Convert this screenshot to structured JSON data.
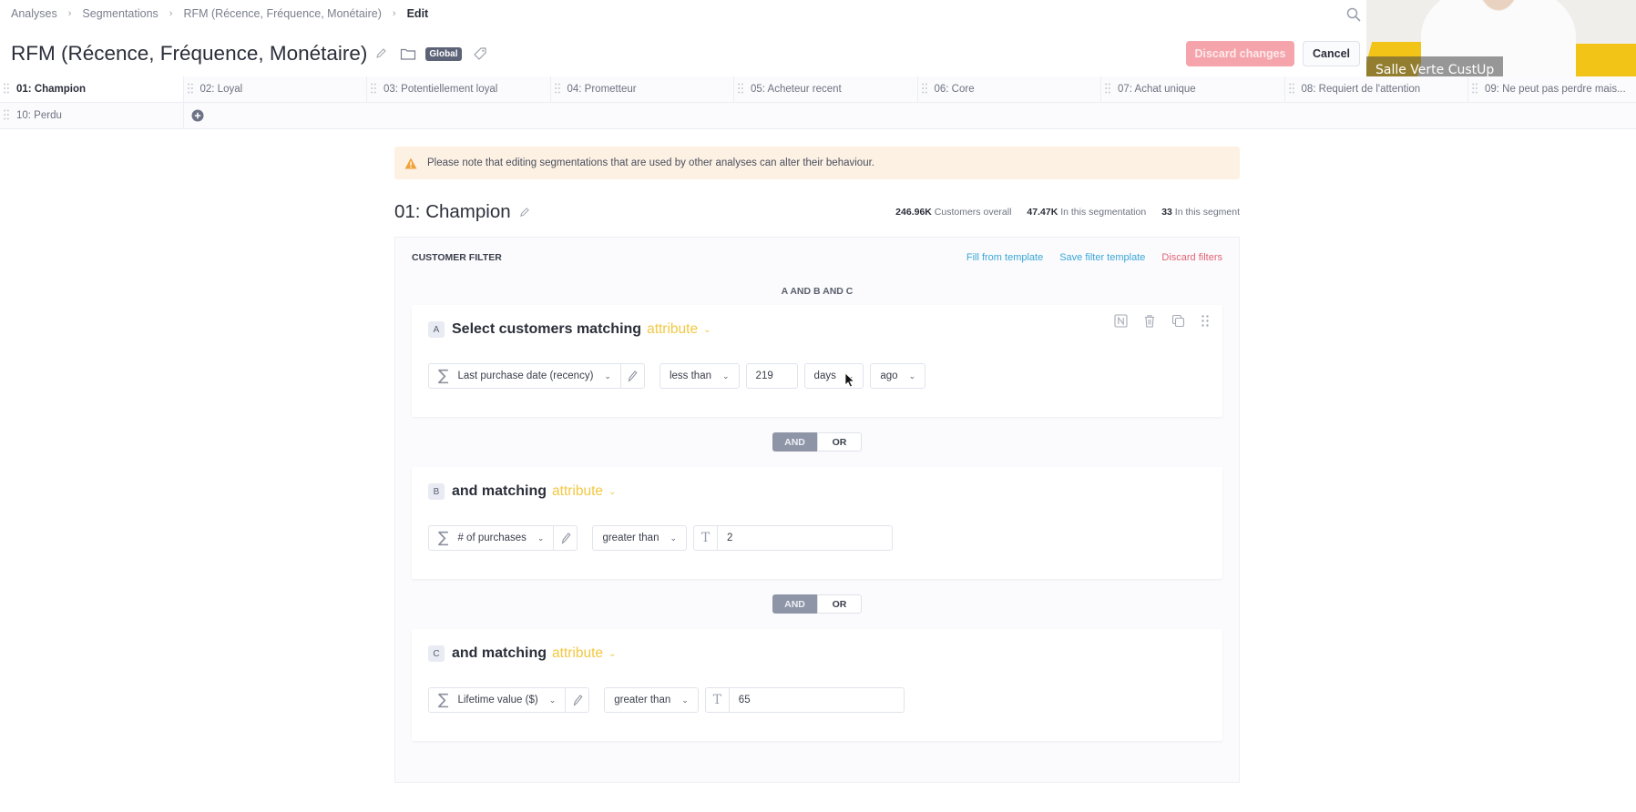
{
  "breadcrumb": [
    {
      "label": "Analyses"
    },
    {
      "label": "Segmentations"
    },
    {
      "label": "RFM (Récence, Fréquence, Monétaire)"
    },
    {
      "label": "Edit"
    }
  ],
  "header": {
    "title": "RFM (Récence, Fréquence, Monétaire)",
    "badge": "Global",
    "discard_label": "Discard changes",
    "cancel_label": "Cancel"
  },
  "video_overlay": {
    "caption": "Salle Verte CustUp"
  },
  "tabs": [
    {
      "label": "01: Champion",
      "active": true
    },
    {
      "label": "02: Loyal"
    },
    {
      "label": "03: Potentiellement loyal"
    },
    {
      "label": "04: Prometteur"
    },
    {
      "label": "05: Acheteur recent"
    },
    {
      "label": "06: Core"
    },
    {
      "label": "07: Achat unique"
    },
    {
      "label": "08: Requiert de l'attention"
    },
    {
      "label": "09: Ne peut pas perdre mais..."
    },
    {
      "label": "10: Perdu"
    }
  ],
  "warning": {
    "text": "Please note that editing segmentations that are used by other analyses can alter their behaviour."
  },
  "segment": {
    "title": "01: Champion",
    "stats": [
      {
        "value": "246.96K",
        "label": "Customers overall"
      },
      {
        "value": "47.47K",
        "label": "In this segmentation"
      },
      {
        "value": "33",
        "label": "In this segment"
      }
    ]
  },
  "filter": {
    "label": "CUSTOMER FILTER",
    "fill_template": "Fill from template",
    "save_template": "Save filter template",
    "discard_filters": "Discard filters",
    "expression": "A AND B AND C",
    "logic_and": "AND",
    "logic_or": "OR",
    "blocks": [
      {
        "letter": "A",
        "title": "Select customers matching",
        "type": "attribute",
        "attribute": "Last purchase date (recency)",
        "operator": "less than",
        "value": "219",
        "unit": "days",
        "direction": "ago"
      },
      {
        "letter": "B",
        "title": "and matching",
        "type": "attribute",
        "attribute": "# of purchases",
        "operator": "greater than",
        "value": "2"
      },
      {
        "letter": "C",
        "title": "and matching",
        "type": "attribute",
        "attribute": "Lifetime value ($)",
        "operator": "greater than",
        "value": "65"
      }
    ]
  }
}
